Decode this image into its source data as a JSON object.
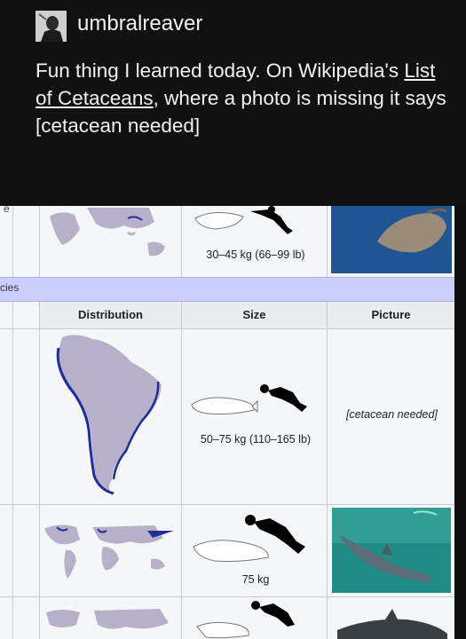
{
  "post": {
    "username": "umbralreaver",
    "text_before_link": "Fun thing I learned today. On Wikipedia's ",
    "link_text": "List of Cetaceans",
    "text_after_link": ", where a photo is missing it says [cetacean needed]"
  },
  "table": {
    "top_row_edge_text": "e",
    "top_row_size": "30–45 kg (66–99 lb)",
    "section_label_fragment": "cies",
    "headers": [
      "Distribution",
      "Size",
      "Picture"
    ],
    "row1_size": "50–75 kg (110–165 lb)",
    "row1_picture": "[cetacean needed]",
    "row2_size": "75 kg"
  },
  "colors": {
    "background": "#111111",
    "text": "#f2f2f2",
    "table_background": "#f5f6f8",
    "section_band": "#cbcffb",
    "header_cell": "#eaecf0",
    "map_land": "#b7b0c9",
    "range_outline": "#1f2f9a",
    "photo_water": "#1f8c86"
  },
  "icons": [
    "user-avatar-icon",
    "diver-silhouette-icon",
    "whale-silhouette-icon"
  ]
}
